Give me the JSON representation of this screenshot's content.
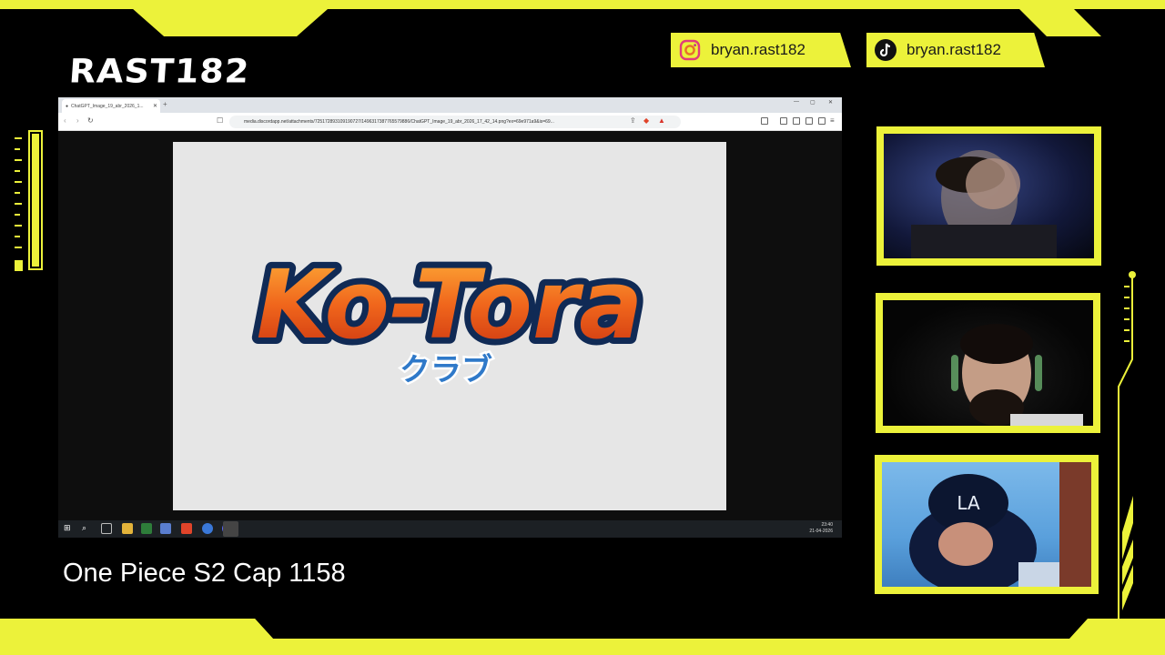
{
  "overlay": {
    "channel_logo": "RAST182",
    "accent_color": "#ecf23a",
    "socials": [
      {
        "icon": "instagram-icon",
        "handle": "bryan.rast182"
      },
      {
        "icon": "tiktok-icon",
        "handle": "bryan.rast182"
      }
    ],
    "caption": "One Piece S2 Cap 1158"
  },
  "browser": {
    "tab_title": "ChatGPT_Image_19_abr_2026_1...",
    "url": "media.discordapp.net/attachments/725172893109190727/1496317387765579886/ChatGPT_Image_19_abr_2026_17_42_14.png?ex=69e971a9&is=69..."
  },
  "image": {
    "title": "Ko-Tora",
    "subtitle": "クラブ"
  },
  "taskbar": {
    "time": "23:40",
    "date": "21-04-2026"
  }
}
